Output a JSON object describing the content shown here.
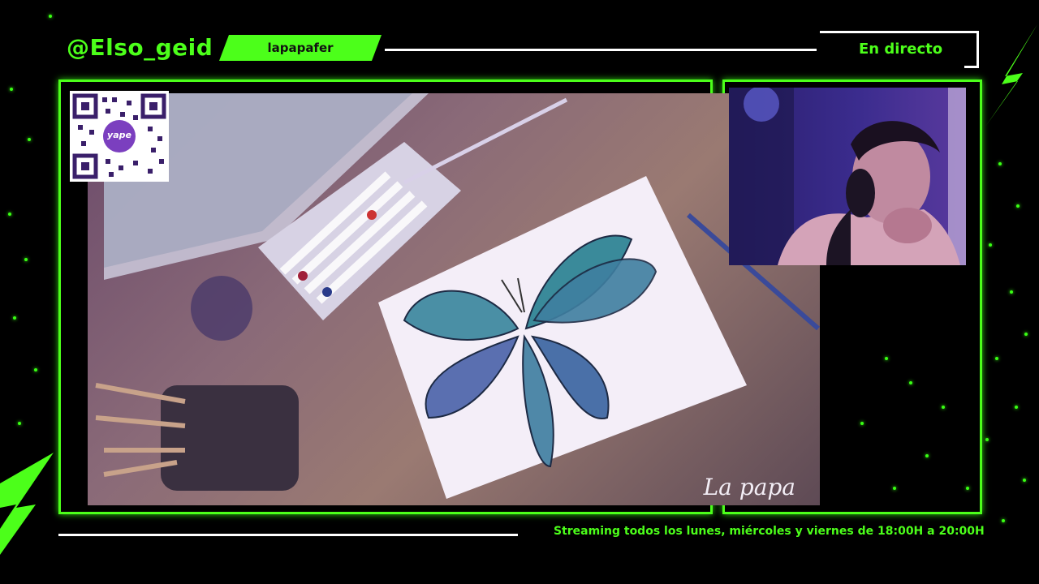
{
  "header": {
    "handle": "@Elso_geid",
    "tag_label": "lapapafer",
    "live_label": "En directo"
  },
  "overlay": {
    "qr_code_label": "yape",
    "signature": "La papa"
  },
  "footer": {
    "schedule_text": "Streaming todos los lunes, miércoles y viernes de 18:00H a 20:00H"
  },
  "colors": {
    "accent": "#4cff1a",
    "background": "#000000",
    "line": "#ffffff"
  },
  "icons": [
    "lightning-bolt-icon",
    "qr-code-icon"
  ]
}
